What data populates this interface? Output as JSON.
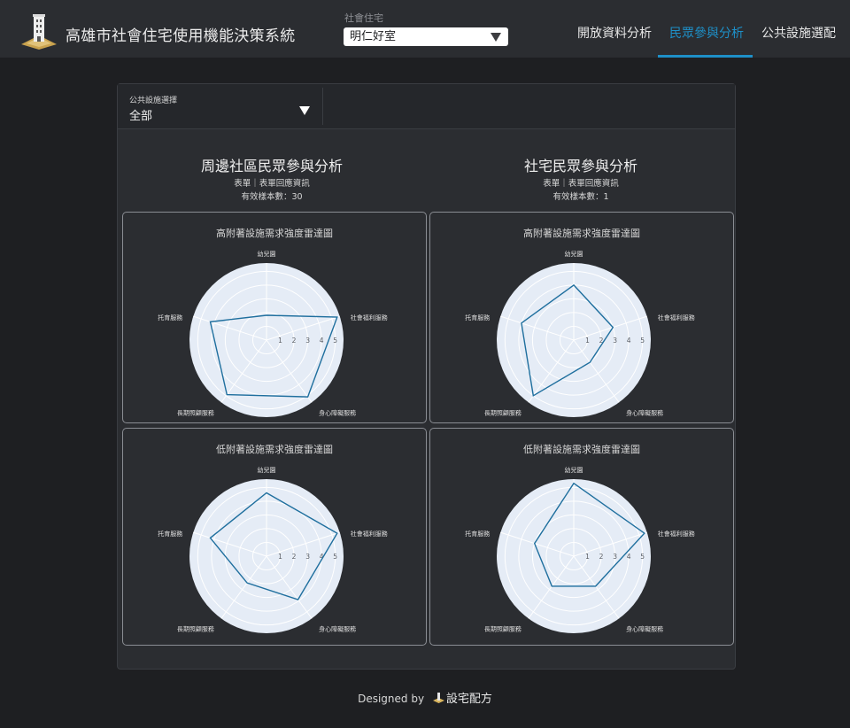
{
  "header": {
    "app_title": "高雄市社會住宅使用機能決策系統",
    "housing_select": {
      "label": "社會住宅",
      "value": "明仁好室"
    },
    "tabs": [
      {
        "label": "開放資料分析",
        "active": false
      },
      {
        "label": "民眾參與分析",
        "active": true
      },
      {
        "label": "公共設施選配",
        "active": false
      }
    ],
    "accent_color": "#1e90c8"
  },
  "filter": {
    "label": "公共設施選擇",
    "value": "全部"
  },
  "sections": [
    {
      "title": "周邊社區民眾參與分析",
      "source": "表單｜表單回應資訊",
      "sample": "有效樣本數：30"
    },
    {
      "title": "社宅民眾參與分析",
      "source": "表單｜表單回應資訊",
      "sample": "有效樣本數：1"
    }
  ],
  "chart_data": [
    {
      "type": "radar",
      "title": "高附著設施需求強度雷達圖",
      "categories": [
        "幼兒園",
        "社會福利服務",
        "身心障礙服務",
        "長期照顧服務",
        "托育服務"
      ],
      "radial_ticks": [
        "1",
        "2",
        "3",
        "4",
        "5"
      ],
      "rmax": 5.6,
      "series": [
        {
          "values": [
            1.8,
            5.4,
            5.1,
            4.9,
            4.3
          ]
        }
      ],
      "line_color": "#1f6f9e"
    },
    {
      "type": "radar",
      "title": "高附著設施需求強度雷達圖",
      "categories": [
        "幼兒園",
        "社會福利服務",
        "身心障礙服務",
        "長期照顧服務",
        "托育服務"
      ],
      "radial_ticks": [
        "1",
        "2",
        "3",
        "4",
        "5"
      ],
      "rmax": 5.6,
      "series": [
        {
          "values": [
            4,
            3,
            2,
            5,
            4
          ]
        }
      ],
      "line_color": "#1f6f9e"
    },
    {
      "type": "radar",
      "title": "低附著設施需求強度雷達圖",
      "categories": [
        "幼兒園",
        "社會福利服務",
        "身心障礙服務",
        "長期照顧服務",
        "托育服務"
      ],
      "radial_ticks": [
        "1",
        "2",
        "3",
        "4",
        "5"
      ],
      "rmax": 5.6,
      "series": [
        {
          "values": [
            4.6,
            5.4,
            3.9,
            2.4,
            4.3
          ]
        }
      ],
      "line_color": "#1f6f9e"
    },
    {
      "type": "radar",
      "title": "低附著設施需求強度雷達圖",
      "categories": [
        "幼兒園",
        "社會福利服務",
        "身心障礙服務",
        "長期照顧服務",
        "托育服務"
      ],
      "radial_ticks": [
        "1",
        "2",
        "3",
        "4",
        "5"
      ],
      "rmax": 5.6,
      "series": [
        {
          "values": [
            5.3,
            5.4,
            2.7,
            2.7,
            3
          ]
        }
      ],
      "line_color": "#1f6f9e"
    }
  ],
  "footer": {
    "designed_by": "Designed by",
    "brand": "設宅配方"
  }
}
